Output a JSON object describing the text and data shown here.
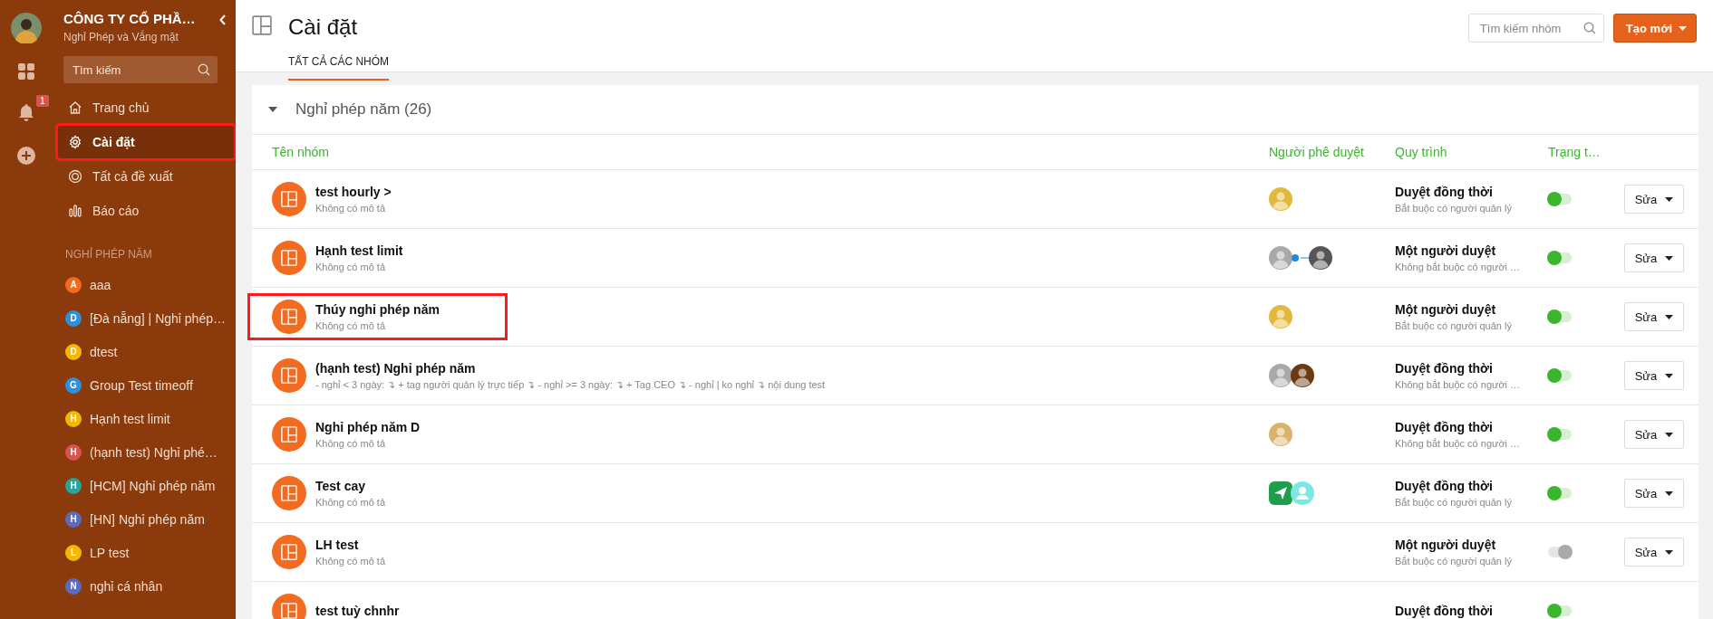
{
  "sidebar": {
    "company": "CÔNG TY CỔ PHẦ…",
    "app_name": "Nghỉ Phép và Vắng mặt",
    "notification_count": "1",
    "search": {
      "placeholder": "Tìm kiếm"
    },
    "nav": [
      {
        "label": "Trang chủ",
        "kind": "home",
        "selected": false,
        "highlighted": false
      },
      {
        "label": "Cài đặt",
        "kind": "gear",
        "selected": true,
        "highlighted": true
      },
      {
        "label": "Tất cả đề xuất",
        "kind": "target",
        "selected": false,
        "highlighted": false
      },
      {
        "label": "Báo cáo",
        "kind": "chart",
        "selected": false,
        "highlighted": false
      }
    ],
    "section_label": "NGHỈ PHÉP NĂM",
    "groups": [
      {
        "letter": "A",
        "label": "aaa",
        "color": "#f26b21"
      },
      {
        "letter": "D",
        "label": "[Đà nẵng] | Nghỉ phép…",
        "color": "#2f8fd8"
      },
      {
        "letter": "D",
        "label": "dtest",
        "color": "#f5b800"
      },
      {
        "letter": "G",
        "label": "Group Test timeoff",
        "color": "#2f8fd8"
      },
      {
        "letter": "H",
        "label": "Hạnh test limit",
        "color": "#f5b800"
      },
      {
        "letter": "H",
        "label": "(hạnh test) Nghỉ phé…",
        "color": "#d9534f"
      },
      {
        "letter": "H",
        "label": "[HCM] Nghỉ phép năm",
        "color": "#26a69a"
      },
      {
        "letter": "H",
        "label": "[HN] Nghỉ phép năm",
        "color": "#5c6bc0"
      },
      {
        "letter": "L",
        "label": "LP test",
        "color": "#f5b800"
      },
      {
        "letter": "N",
        "label": "nghỉ cá nhân",
        "color": "#5c6bc0"
      }
    ]
  },
  "header": {
    "title": "Cài đặt",
    "tabs": [
      {
        "label": "TẤT CẢ CÁC NHÓM",
        "selected": true
      }
    ],
    "search": {
      "placeholder": "Tìm kiếm nhóm"
    },
    "create_button": "Tạo mới"
  },
  "section": {
    "title": "Nghỉ phép năm (26)",
    "expanded": true,
    "columns": [
      "Tên nhóm",
      "Người phê duyệt",
      "Quy trình",
      "Trạng t…"
    ],
    "rows": [
      {
        "name": "test hourly >",
        "description": "Không có mô tả",
        "approvers": [
          {
            "kind": "photo",
            "color": "#e2b93b"
          }
        ],
        "process": "Duyệt đồng thời",
        "rule": "Bắt buộc có người quản lý",
        "on": true,
        "edit": "Sửa",
        "highlighted": false
      },
      {
        "name": "Hạnh test limit",
        "description": "Không có mô tả",
        "approvers": [
          {
            "kind": "photo",
            "color": "#a9a9a9"
          },
          {
            "kind": "logo",
            "color": "#1e88e5"
          },
          {
            "kind": "photo",
            "color": "#555555"
          }
        ],
        "process": "Một người duyệt",
        "rule": "Không bắt buộc có người …",
        "on": true,
        "edit": "Sửa",
        "highlighted": false
      },
      {
        "name": "Thúy nghỉ phép năm",
        "description": "Không có mô tả",
        "approvers": [
          {
            "kind": "photo",
            "color": "#e2b93b"
          }
        ],
        "process": "Một người duyệt",
        "rule": "Bắt buộc có người quản lý",
        "on": true,
        "edit": "Sửa",
        "highlighted": true
      },
      {
        "name": "(hạnh test) Nghỉ phép năm",
        "description": "- nghỉ < 3 ngày: ↴ + tag người quản lý trực tiếp ↴ - nghỉ >= 3 ngày: ↴ + Tag CEO ↴ - nghỉ | ko nghỉ ↴ nội dung test",
        "approvers": [
          {
            "kind": "photo",
            "color": "#a9a9a9"
          },
          {
            "kind": "photo",
            "color": "#6b3a10"
          }
        ],
        "process": "Duyệt đồng thời",
        "rule": "Không bắt buộc có người …",
        "on": true,
        "edit": "Sửa",
        "highlighted": false
      },
      {
        "name": "Nghỉ phép năm D",
        "description": "Không có mô tả",
        "approvers": [
          {
            "kind": "photo",
            "color": "#d9b36a"
          }
        ],
        "process": "Duyệt đồng thời",
        "rule": "Không bắt buộc có người …",
        "on": true,
        "edit": "Sửa",
        "highlighted": false
      },
      {
        "name": "Test cay",
        "description": "Không có mô tả",
        "approvers": [
          {
            "kind": "app",
            "color": "#1e9e4a"
          },
          {
            "kind": "default",
            "color": "#7fe6e6"
          }
        ],
        "process": "Duyệt đồng thời",
        "rule": "Bắt buộc có người quản lý",
        "on": true,
        "edit": "Sửa",
        "highlighted": false
      },
      {
        "name": "LH test",
        "description": "Không có mô tả",
        "approvers": [],
        "process": "Một người duyệt",
        "rule": "Bắt buộc có người quản lý",
        "on": false,
        "edit": "Sửa",
        "highlighted": false
      },
      {
        "name": "test tuỳ chnhr",
        "approvers": [],
        "process": "Duyệt đồng thời",
        "on": true,
        "highlighted": false
      }
    ]
  }
}
